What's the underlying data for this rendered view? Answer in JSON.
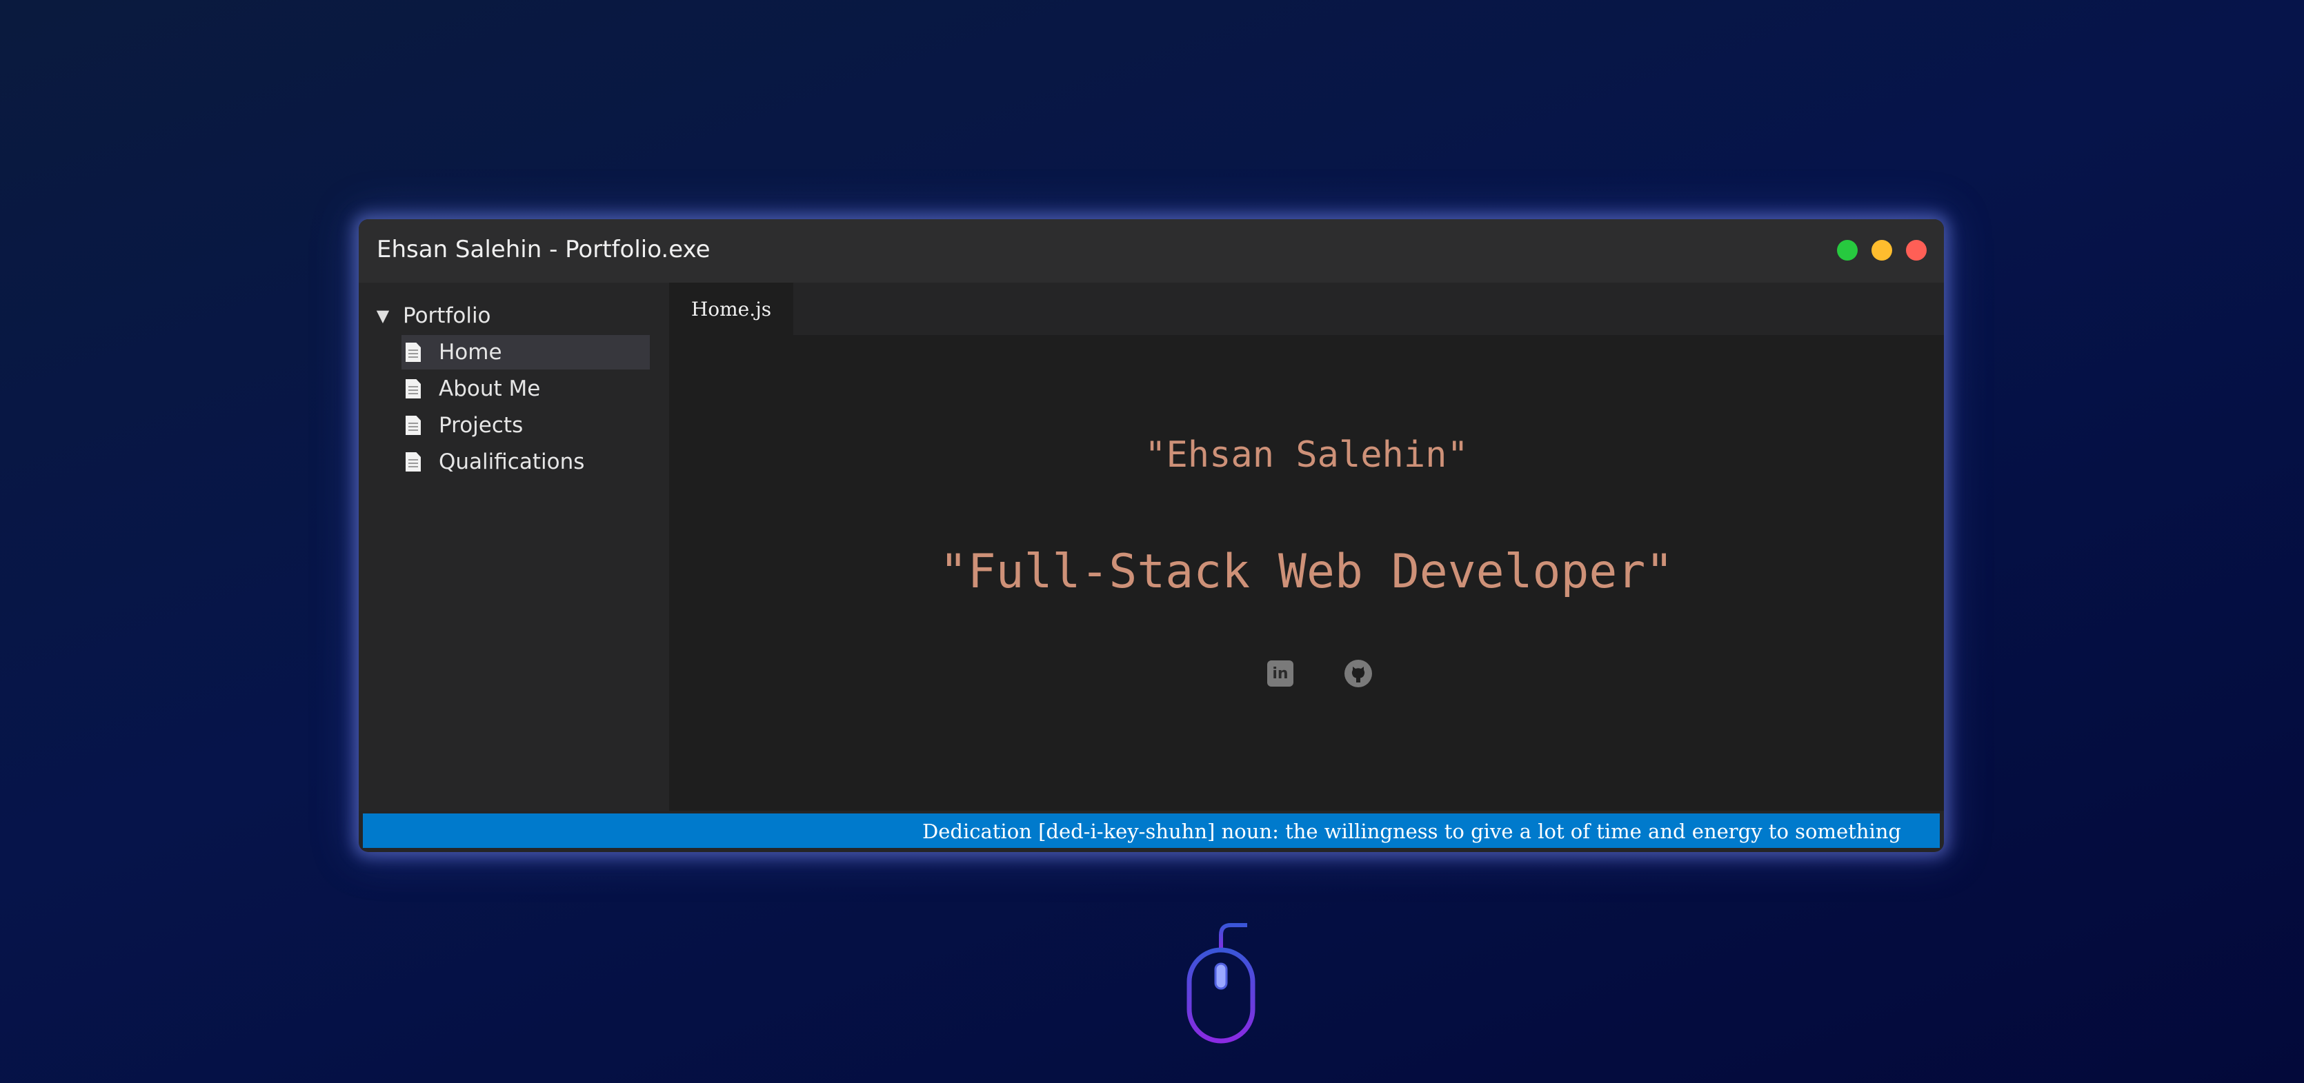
{
  "window": {
    "title": "Ehsan Salehin - Portfolio.exe",
    "controls": {
      "green": "#27c93f",
      "yellow": "#ffbd2e",
      "red": "#ff5f56"
    }
  },
  "sidebar": {
    "folder_label": "Portfolio",
    "items": [
      {
        "label": "Home",
        "active": true
      },
      {
        "label": "About Me",
        "active": false
      },
      {
        "label": "Projects",
        "active": false
      },
      {
        "label": "Qualifications",
        "active": false
      }
    ]
  },
  "editor": {
    "tab_label": "Home.js",
    "name_line": "\"Ehsan Salehin\"",
    "role_line": "\"Full-Stack Web Developer\"",
    "string_color": "#ce9178",
    "social": [
      {
        "icon": "linkedin-icon"
      },
      {
        "icon": "github-icon"
      }
    ]
  },
  "statusbar": {
    "text": "Dedication [ded-i-key-shuhn] noun: the willingness to give a lot of time and energy to something",
    "color": "#007acc"
  },
  "scroll_hint": {
    "icon": "mouse-scroll-icon"
  }
}
